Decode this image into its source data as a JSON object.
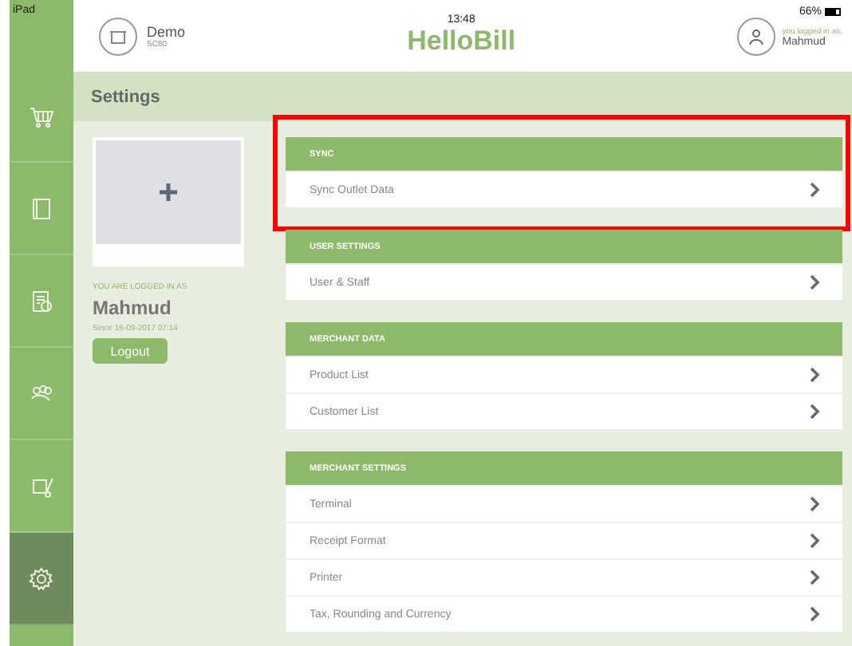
{
  "status_bar": {
    "device": "iPad",
    "time": "13:48",
    "battery": "66%"
  },
  "header": {
    "store_name": "Demo",
    "store_code": "SC80",
    "logo": "HelloBill",
    "user_caption": "you logged in as,",
    "user_name": "Mahmud"
  },
  "sidebar": {
    "items": [
      {
        "kind": "cart",
        "selected": false
      },
      {
        "kind": "book",
        "selected": false
      },
      {
        "kind": "report",
        "selected": false
      },
      {
        "kind": "people",
        "selected": false
      },
      {
        "kind": "trolley",
        "selected": false
      },
      {
        "kind": "settings",
        "selected": true
      }
    ]
  },
  "page_title": "Settings",
  "profile": {
    "caption": "YOU ARE LOGGED IN AS",
    "name": "Mahmud",
    "since": "Since 16-09-2017 07:14",
    "logout": "Logout"
  },
  "sections": [
    {
      "title": "SYNC",
      "highlighted": true,
      "items": [
        "Sync Outlet Data"
      ]
    },
    {
      "title": "USER SETTINGS",
      "highlighted": false,
      "items": [
        "User & Staff"
      ]
    },
    {
      "title": "MERCHANT DATA",
      "highlighted": false,
      "items": [
        "Product List",
        "Customer List"
      ]
    },
    {
      "title": "MERCHANT SETTINGS",
      "highlighted": false,
      "items": [
        "Terminal",
        "Receipt Format",
        "Printer",
        "Tax, Rounding and Currency"
      ]
    }
  ]
}
